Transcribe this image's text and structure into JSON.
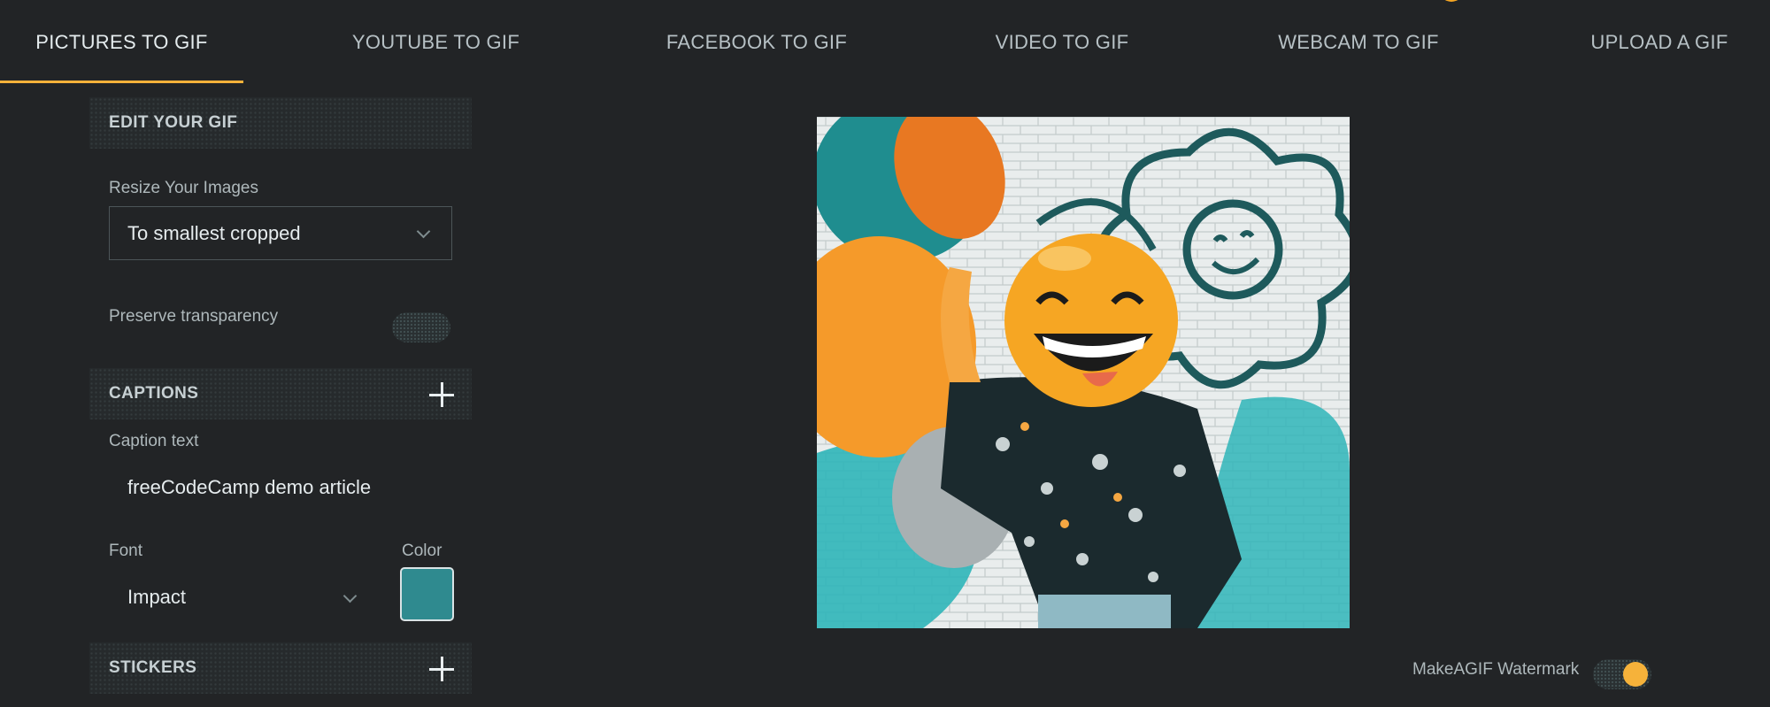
{
  "tabs": [
    {
      "label": "PICTURES TO GIF",
      "active": true
    },
    {
      "label": "YOUTUBE TO GIF",
      "active": false
    },
    {
      "label": "FACEBOOK TO GIF",
      "active": false
    },
    {
      "label": "VIDEO TO GIF",
      "active": false
    },
    {
      "label": "WEBCAM TO GIF",
      "active": false
    },
    {
      "label": "UPLOAD A GIF",
      "active": false
    }
  ],
  "edit": {
    "header": "EDIT YOUR GIF",
    "resize_label": "Resize Your Images",
    "resize_value": "To smallest cropped",
    "preserve_label": "Preserve transparency",
    "preserve_on": false
  },
  "captions": {
    "header": "CAPTIONS",
    "caption_label": "Caption text",
    "caption_value": "freeCodeCamp demo article",
    "font_label": "Font",
    "font_value": "Impact",
    "color_label": "Color",
    "color_value": "#2f8a8f"
  },
  "stickers": {
    "header": "STICKERS"
  },
  "watermark": {
    "label": "MakeAGIF Watermark",
    "on": true
  },
  "colors": {
    "accent": "#f6b23a",
    "background": "#222426"
  },
  "icons": {
    "captions_add": "plus-icon",
    "stickers_add": "plus-icon",
    "dropdown": "chevron-down-icon"
  }
}
